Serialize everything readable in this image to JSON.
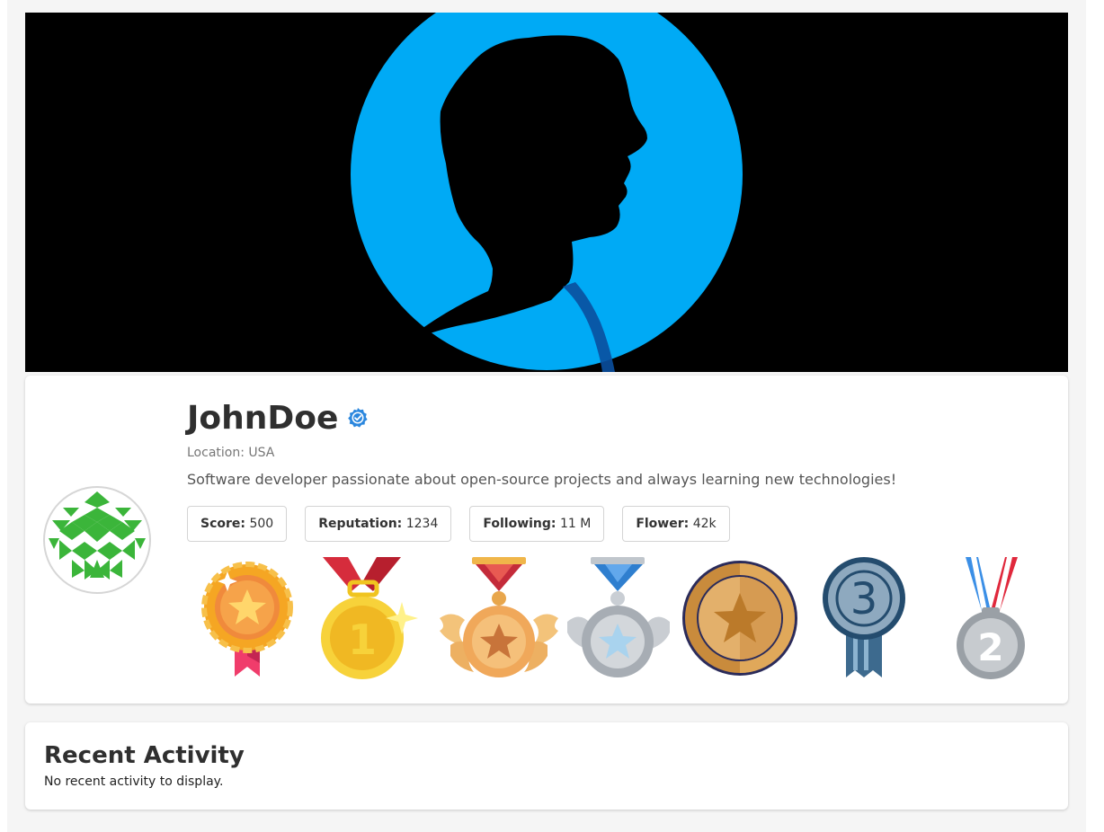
{
  "profile": {
    "username": "JohnDoe",
    "verified": true,
    "location_label": "Location:",
    "location_value": "USA",
    "bio": "Software developer passionate about open-source projects and always learning new technologies!",
    "stats": [
      {
        "label": "Score:",
        "value": "500"
      },
      {
        "label": "Reputation:",
        "value": "1234"
      },
      {
        "label": "Following:",
        "value": "11 M"
      },
      {
        "label": "Flower:",
        "value": "42k"
      }
    ],
    "badges": [
      "gold-star-rosette-medal-icon",
      "first-place-gold-medal-icon",
      "winged-bronze-star-medal-icon",
      "winged-silver-star-medal-icon",
      "bronze-star-coin-medal-icon",
      "third-place-ribbon-icon",
      "second-place-silver-medal-icon"
    ]
  },
  "activity": {
    "title": "Recent Activity",
    "empty_text": "No recent activity to display."
  },
  "colors": {
    "banner_circle": "#00aaf5",
    "verified": "#2b87de",
    "avatar_pattern": "#3bb53a"
  }
}
